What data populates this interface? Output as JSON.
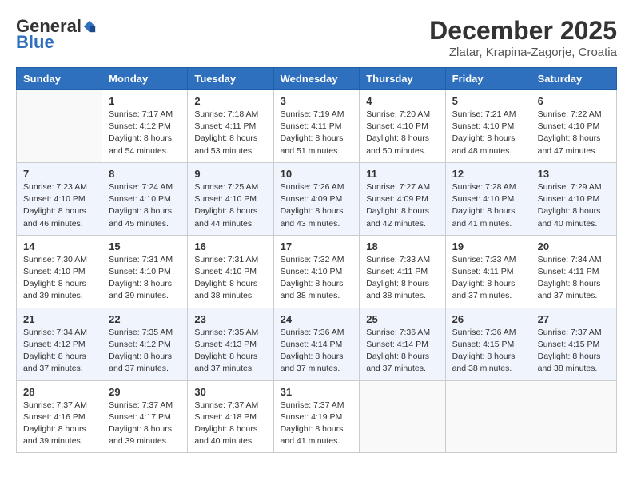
{
  "logo": {
    "general": "General",
    "blue": "Blue"
  },
  "header": {
    "month": "December 2025",
    "location": "Zlatar, Krapina-Zagorje, Croatia"
  },
  "weekdays": [
    "Sunday",
    "Monday",
    "Tuesday",
    "Wednesday",
    "Thursday",
    "Friday",
    "Saturday"
  ],
  "weeks": [
    [
      {
        "day": "",
        "info": ""
      },
      {
        "day": "1",
        "info": "Sunrise: 7:17 AM\nSunset: 4:12 PM\nDaylight: 8 hours\nand 54 minutes."
      },
      {
        "day": "2",
        "info": "Sunrise: 7:18 AM\nSunset: 4:11 PM\nDaylight: 8 hours\nand 53 minutes."
      },
      {
        "day": "3",
        "info": "Sunrise: 7:19 AM\nSunset: 4:11 PM\nDaylight: 8 hours\nand 51 minutes."
      },
      {
        "day": "4",
        "info": "Sunrise: 7:20 AM\nSunset: 4:10 PM\nDaylight: 8 hours\nand 50 minutes."
      },
      {
        "day": "5",
        "info": "Sunrise: 7:21 AM\nSunset: 4:10 PM\nDaylight: 8 hours\nand 48 minutes."
      },
      {
        "day": "6",
        "info": "Sunrise: 7:22 AM\nSunset: 4:10 PM\nDaylight: 8 hours\nand 47 minutes."
      }
    ],
    [
      {
        "day": "7",
        "info": "Sunrise: 7:23 AM\nSunset: 4:10 PM\nDaylight: 8 hours\nand 46 minutes."
      },
      {
        "day": "8",
        "info": "Sunrise: 7:24 AM\nSunset: 4:10 PM\nDaylight: 8 hours\nand 45 minutes."
      },
      {
        "day": "9",
        "info": "Sunrise: 7:25 AM\nSunset: 4:10 PM\nDaylight: 8 hours\nand 44 minutes."
      },
      {
        "day": "10",
        "info": "Sunrise: 7:26 AM\nSunset: 4:09 PM\nDaylight: 8 hours\nand 43 minutes."
      },
      {
        "day": "11",
        "info": "Sunrise: 7:27 AM\nSunset: 4:09 PM\nDaylight: 8 hours\nand 42 minutes."
      },
      {
        "day": "12",
        "info": "Sunrise: 7:28 AM\nSunset: 4:10 PM\nDaylight: 8 hours\nand 41 minutes."
      },
      {
        "day": "13",
        "info": "Sunrise: 7:29 AM\nSunset: 4:10 PM\nDaylight: 8 hours\nand 40 minutes."
      }
    ],
    [
      {
        "day": "14",
        "info": "Sunrise: 7:30 AM\nSunset: 4:10 PM\nDaylight: 8 hours\nand 39 minutes."
      },
      {
        "day": "15",
        "info": "Sunrise: 7:31 AM\nSunset: 4:10 PM\nDaylight: 8 hours\nand 39 minutes."
      },
      {
        "day": "16",
        "info": "Sunrise: 7:31 AM\nSunset: 4:10 PM\nDaylight: 8 hours\nand 38 minutes."
      },
      {
        "day": "17",
        "info": "Sunrise: 7:32 AM\nSunset: 4:10 PM\nDaylight: 8 hours\nand 38 minutes."
      },
      {
        "day": "18",
        "info": "Sunrise: 7:33 AM\nSunset: 4:11 PM\nDaylight: 8 hours\nand 38 minutes."
      },
      {
        "day": "19",
        "info": "Sunrise: 7:33 AM\nSunset: 4:11 PM\nDaylight: 8 hours\nand 37 minutes."
      },
      {
        "day": "20",
        "info": "Sunrise: 7:34 AM\nSunset: 4:11 PM\nDaylight: 8 hours\nand 37 minutes."
      }
    ],
    [
      {
        "day": "21",
        "info": "Sunrise: 7:34 AM\nSunset: 4:12 PM\nDaylight: 8 hours\nand 37 minutes."
      },
      {
        "day": "22",
        "info": "Sunrise: 7:35 AM\nSunset: 4:12 PM\nDaylight: 8 hours\nand 37 minutes."
      },
      {
        "day": "23",
        "info": "Sunrise: 7:35 AM\nSunset: 4:13 PM\nDaylight: 8 hours\nand 37 minutes."
      },
      {
        "day": "24",
        "info": "Sunrise: 7:36 AM\nSunset: 4:14 PM\nDaylight: 8 hours\nand 37 minutes."
      },
      {
        "day": "25",
        "info": "Sunrise: 7:36 AM\nSunset: 4:14 PM\nDaylight: 8 hours\nand 37 minutes."
      },
      {
        "day": "26",
        "info": "Sunrise: 7:36 AM\nSunset: 4:15 PM\nDaylight: 8 hours\nand 38 minutes."
      },
      {
        "day": "27",
        "info": "Sunrise: 7:37 AM\nSunset: 4:15 PM\nDaylight: 8 hours\nand 38 minutes."
      }
    ],
    [
      {
        "day": "28",
        "info": "Sunrise: 7:37 AM\nSunset: 4:16 PM\nDaylight: 8 hours\nand 39 minutes."
      },
      {
        "day": "29",
        "info": "Sunrise: 7:37 AM\nSunset: 4:17 PM\nDaylight: 8 hours\nand 39 minutes."
      },
      {
        "day": "30",
        "info": "Sunrise: 7:37 AM\nSunset: 4:18 PM\nDaylight: 8 hours\nand 40 minutes."
      },
      {
        "day": "31",
        "info": "Sunrise: 7:37 AM\nSunset: 4:19 PM\nDaylight: 8 hours\nand 41 minutes."
      },
      {
        "day": "",
        "info": ""
      },
      {
        "day": "",
        "info": ""
      },
      {
        "day": "",
        "info": ""
      }
    ]
  ]
}
